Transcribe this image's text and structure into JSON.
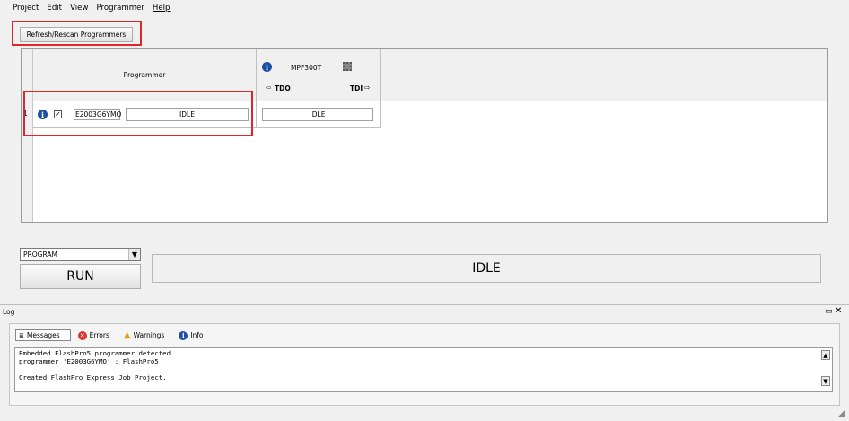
{
  "menu": {
    "items": [
      "Project",
      "Edit",
      "View",
      "Programmer",
      "Help"
    ]
  },
  "toolbar": {
    "refresh_label": "Refresh/Rescan Programmers"
  },
  "grid": {
    "programmer_header": "Programmer",
    "device_name": "MPF300T",
    "tdo_label": "TDO",
    "tdi_label": "TDI",
    "rows": [
      {
        "index": "1",
        "checked": "✓",
        "programmer_id": "E2003G6YMO",
        "programmer_status": "IDLE",
        "device_status": "IDLE"
      }
    ]
  },
  "action": {
    "selected": "PROGRAM",
    "run_label": "RUN",
    "status": "IDLE"
  },
  "log": {
    "title": "Log",
    "tabs": [
      "Messages",
      "Errors",
      "Warnings",
      "Info"
    ],
    "lines": [
      "Embedded FlashPro5 programmer detected.",
      "programmer 'E2003G6YMO' : FlashPro5",
      "",
      "Created FlashPro Express Job Project."
    ]
  }
}
